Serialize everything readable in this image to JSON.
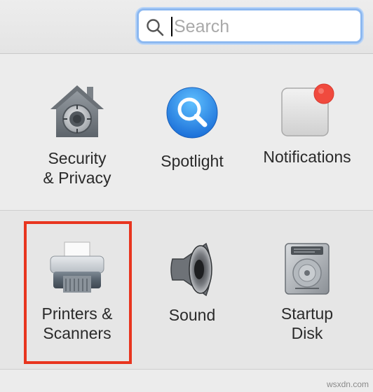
{
  "search": {
    "placeholder": "Search",
    "icon": "magnifier-icon"
  },
  "prefs": {
    "row1": [
      {
        "label": "Security\n& Privacy",
        "icon": "security-house-icon"
      },
      {
        "label": "Spotlight",
        "icon": "spotlight-icon"
      },
      {
        "label": "Notifications",
        "icon": "notifications-icon"
      }
    ],
    "row2": [
      {
        "label": "Printers &\nScanners",
        "icon": "printer-icon"
      },
      {
        "label": "Sound",
        "icon": "speaker-icon"
      },
      {
        "label": "Startup\nDisk",
        "icon": "hard-disk-icon"
      }
    ]
  },
  "colors": {
    "highlight": "#e8351f",
    "search_focus": "#8cb8f0",
    "notification_dot": "#f04a3e",
    "spotlight_blue": "#2a8df0"
  },
  "watermark": "wsxdn.com"
}
